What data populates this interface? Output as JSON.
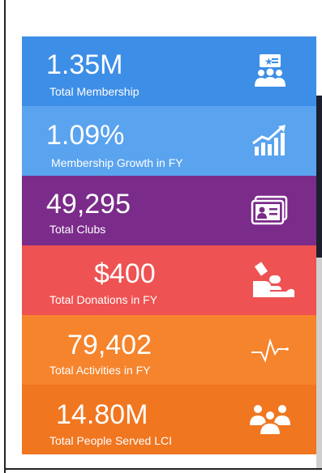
{
  "cards": [
    {
      "value": "1.35M",
      "label": "Total Membership",
      "color": "#3d8ee6",
      "icon": "membership-icon"
    },
    {
      "value": "1.09%",
      "label": "Membership Growth in FY",
      "color": "#5aa3ef",
      "icon": "growth-chart-icon"
    },
    {
      "value": "49,295",
      "label": "Total Clubs",
      "color": "#7b2b8a",
      "icon": "id-card-icon"
    },
    {
      "value": "$400",
      "label": "Total Donations in FY",
      "color": "#ee5252",
      "icon": "donation-icon"
    },
    {
      "value": "79,402",
      "label": "Total Activities in FY",
      "color": "#f5842d",
      "icon": "activity-pulse-icon"
    },
    {
      "value": "14.80M",
      "label": "Total People Served LCI",
      "color": "#f07620",
      "icon": "people-group-icon"
    }
  ]
}
